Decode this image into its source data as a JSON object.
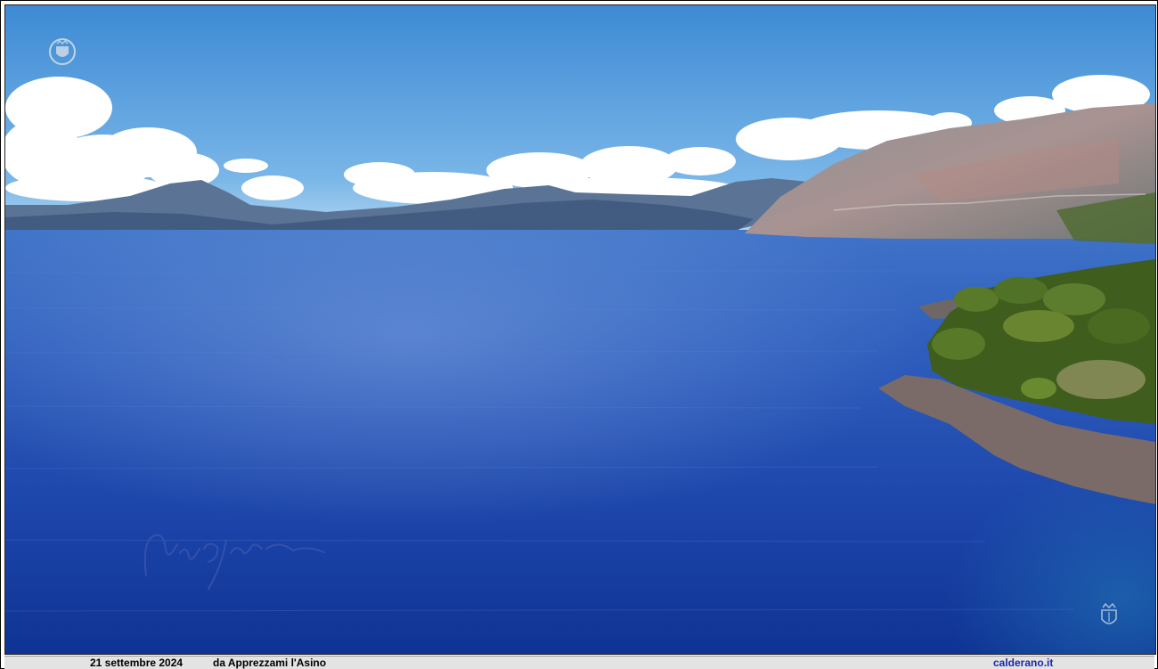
{
  "photo": {
    "subject": "",
    "colors": {
      "sky_top": "#3f8fd6",
      "sky_horizon": "#a8d0ef",
      "sea_far": "#3a6cc4",
      "sea_near": "#10349c",
      "mountains_far": "#5d7596",
      "cliff": "#9d8f8e",
      "vegetation": "#4a6a24",
      "rocks": "#7d6f6c"
    }
  },
  "watermarks": {
    "top_left_emblem_icon": "crest-emblem-icon",
    "bottom_right_emblem_icon": "crest-emblem-icon",
    "signature_icon": "handwritten-signature-icon"
  },
  "caption": {
    "date": "21 settembre 2024",
    "source": "da Apprezzami l'Asino",
    "site": "calderano.it"
  }
}
